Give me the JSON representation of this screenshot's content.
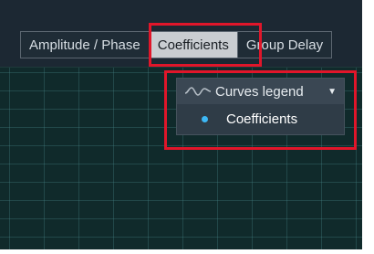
{
  "tabs": [
    {
      "label": "Amplitude / Phase",
      "active": false
    },
    {
      "label": "Coefficients",
      "active": true
    },
    {
      "label": "Group Delay",
      "active": false
    }
  ],
  "legend": {
    "title": "Curves legend",
    "icon": "waveform-icon",
    "toggle_icon": "caret-down-icon",
    "items": [
      {
        "label": "Coefficients",
        "color": "#3db8f5"
      }
    ]
  },
  "colors": {
    "panel_background": "#1c2833",
    "plot_background": "#102a2b",
    "active_tab": "#c9cdd1",
    "highlight": "#e0162a"
  }
}
